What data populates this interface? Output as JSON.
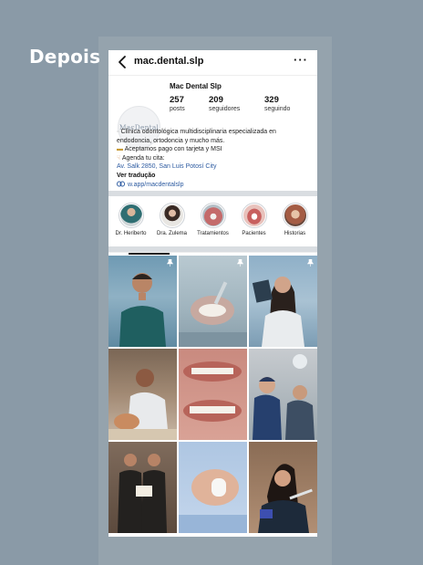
{
  "caption": "Depois",
  "header": {
    "username": "mac.dental.slp"
  },
  "profile": {
    "logo_text": "MacDental",
    "display_name": "Mac Dental Slp",
    "stats": [
      {
        "value": "257",
        "label": "posts"
      },
      {
        "value": "209",
        "label": "seguidores"
      },
      {
        "value": "329",
        "label": "seguindo"
      }
    ],
    "bio": {
      "line1": "Clínica odontológica multidisciplinaria especializada en",
      "line2": "endodoncia, ortodoncia y mucho más.",
      "line3": "Aceptamos pago con tarjeta y MSI",
      "line4": "Agenda tu cita:",
      "location": "Av. Salk 2850, San Luis Potosí City",
      "translate": "Ver tradução",
      "link": "w.app/macdentalslp"
    }
  },
  "highlights": [
    {
      "label": "Dr. Heriberto",
      "color": "#7d8f8a"
    },
    {
      "label": "Dra. Zulema",
      "color": "#b8a89a"
    },
    {
      "label": "Tratamientos",
      "color": "#d19a94"
    },
    {
      "label": "Pacientes",
      "color": "#e8c2bc"
    },
    {
      "label": "Historias",
      "color": "#b9846f"
    }
  ],
  "posts": [
    {
      "kind": "doctor-portrait",
      "pinned": true
    },
    {
      "kind": "treatment-photo",
      "pinned": true
    },
    {
      "kind": "doctor-portrait",
      "pinned": true
    },
    {
      "kind": "clinic-photo",
      "pinned": false
    },
    {
      "kind": "smile-photo",
      "pinned": false
    },
    {
      "kind": "clinic-photo",
      "pinned": false
    },
    {
      "kind": "team-photo",
      "pinned": false
    },
    {
      "kind": "product-photo",
      "pinned": false
    },
    {
      "kind": "clinic-photo",
      "pinned": false
    }
  ]
}
